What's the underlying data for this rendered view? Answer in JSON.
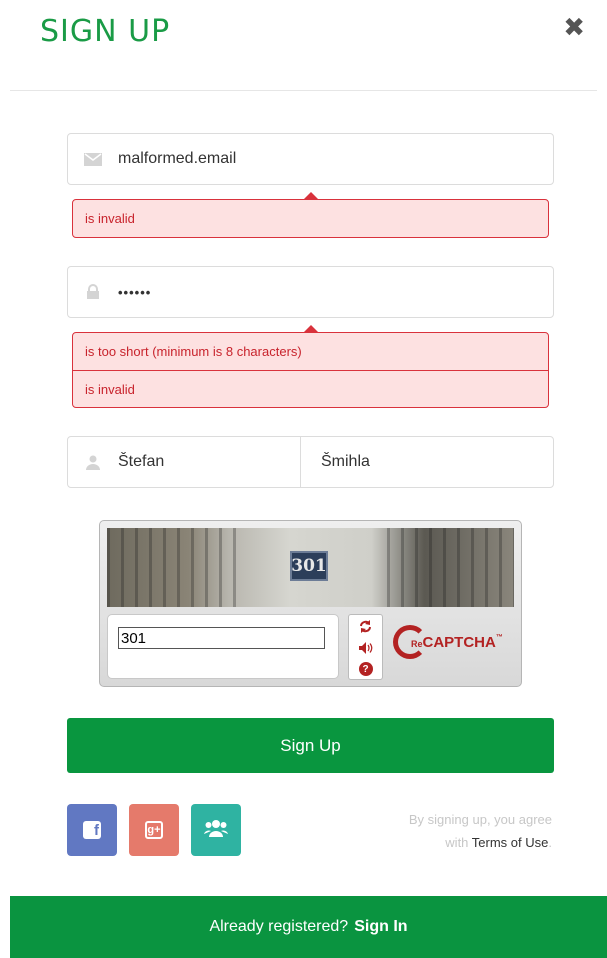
{
  "header": {
    "title": "SIGN UP",
    "close_label": "✖"
  },
  "email": {
    "value": "malformed.email",
    "icon": "envelope-icon",
    "errors": [
      "is invalid"
    ]
  },
  "password": {
    "value": "••••••",
    "icon": "lock-icon",
    "errors": [
      "is too short (minimum is 8 characters)",
      "is invalid"
    ]
  },
  "name": {
    "first": "Štefan",
    "last": "Šmihla",
    "icon": "user-icon"
  },
  "captcha": {
    "image_text": "301",
    "input_value": "301",
    "logo_prefix": "Re",
    "logo_text": "CAPTCHA",
    "logo_tm": "™"
  },
  "submit": {
    "label": "Sign Up"
  },
  "terms": {
    "line1": "By signing up, you agree",
    "line2_prefix": "with ",
    "link": "Terms of Use",
    "suffix": "."
  },
  "footer": {
    "text": "Already registered?",
    "link": "Sign In"
  },
  "colors": {
    "brand_green": "#09963f",
    "error_red": "#d9323c",
    "facebook": "#6178c2",
    "google": "#e57a6b",
    "group": "#2fb3a2"
  }
}
